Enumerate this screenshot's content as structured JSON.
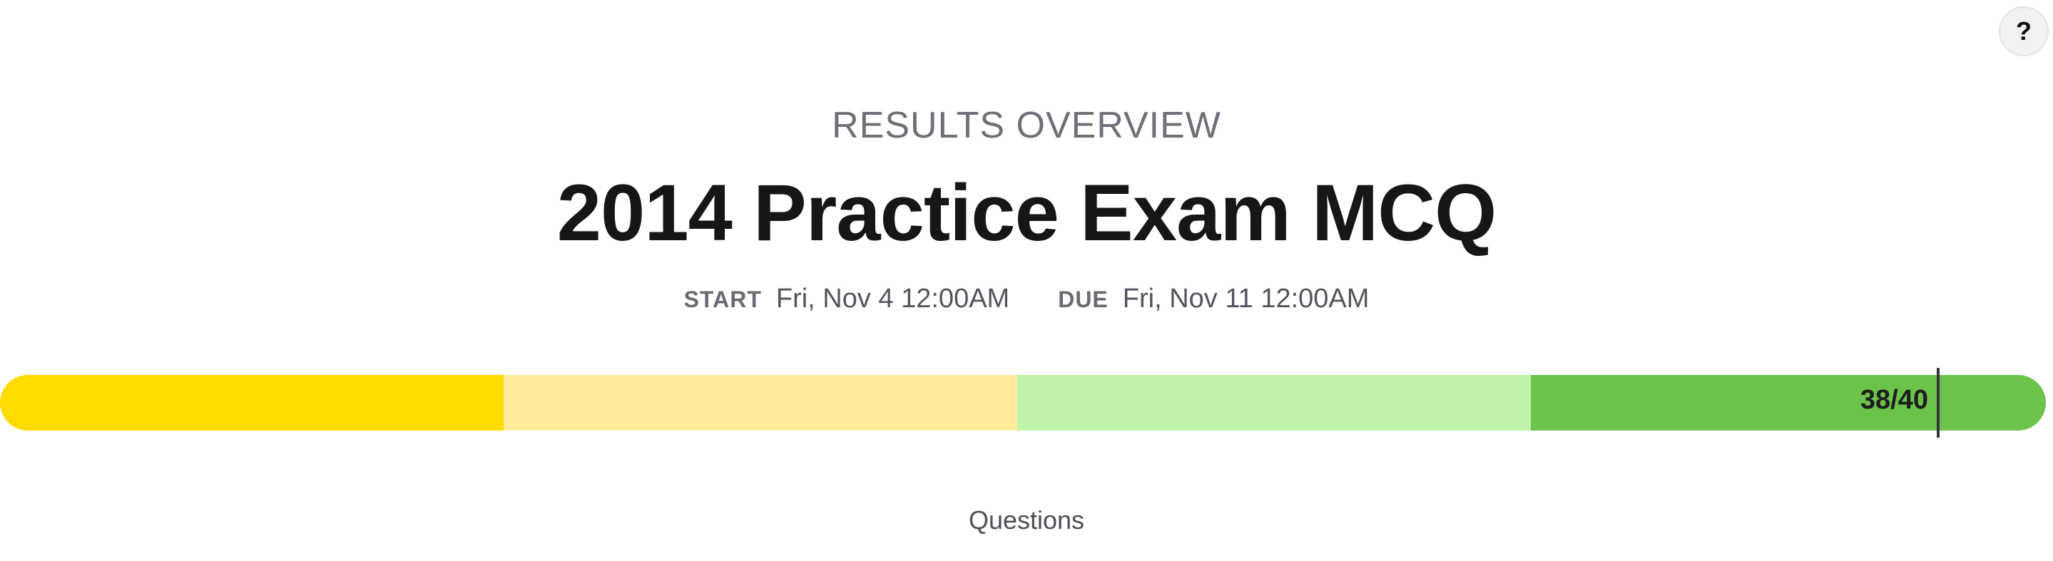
{
  "help_button": {
    "label": "?"
  },
  "header": {
    "eyebrow": "RESULTS OVERVIEW",
    "title": "2014 Practice Exam MCQ"
  },
  "dates": {
    "start_label": "START",
    "start_value": "Fri, Nov 4 12:00AM",
    "due_label": "DUE",
    "due_value": "Fri, Nov 11 12:00AM"
  },
  "score": {
    "label": "38/40",
    "earned": 38,
    "total": 40,
    "band_colors": [
      "#ffdb00",
      "#ffeb9c",
      "#bff4aa",
      "#6cc34b"
    ]
  },
  "sections": {
    "questions_heading": "Questions"
  }
}
